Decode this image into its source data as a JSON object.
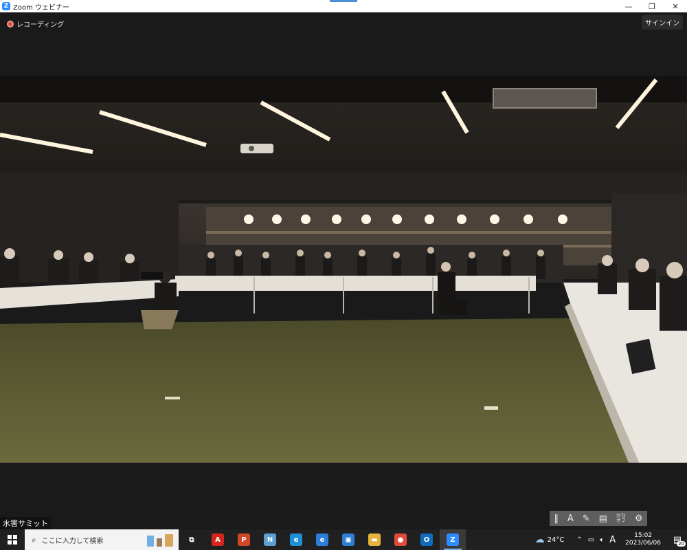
{
  "window": {
    "title": "Zoom ウェビナー",
    "app_icon_letter": "Z",
    "minimize": "—",
    "maximize": "❐",
    "close": "✕"
  },
  "zoom": {
    "recording_label": "レコーディング",
    "signin_label": "サインイン",
    "caption_label": "水害サミット"
  },
  "toolpanel": {
    "grip": "‖",
    "text_tool": "A",
    "kana_top": "かな",
    "kana_bottom": "オフ",
    "settings": "⚙"
  },
  "taskbar": {
    "search_placeholder": "ここに入力して検索",
    "apps": [
      {
        "name": "task-view-icon",
        "glyph": "⧉",
        "color": "#202020"
      },
      {
        "name": "acrobat-icon",
        "glyph": "A",
        "color": "#d4261f"
      },
      {
        "name": "powerpoint-icon",
        "glyph": "P",
        "color": "#d24726"
      },
      {
        "name": "notepad-icon",
        "glyph": "N",
        "color": "#5aa0d6"
      },
      {
        "name": "edge-icon",
        "glyph": "e",
        "color": "#1f8fd6"
      },
      {
        "name": "ie-icon",
        "glyph": "e",
        "color": "#2b7fd8"
      },
      {
        "name": "store-icon",
        "glyph": "▣",
        "color": "#2d7fd4"
      },
      {
        "name": "explorer-icon",
        "glyph": "▬",
        "color": "#e8b33c"
      },
      {
        "name": "chrome-icon",
        "glyph": "●",
        "color": "#dd4b39"
      },
      {
        "name": "outlook-icon",
        "glyph": "O",
        "color": "#0f6cbd"
      },
      {
        "name": "zoom-icon",
        "glyph": "Z",
        "color": "#2d8cff"
      }
    ],
    "temperature": "24°C",
    "ime": "A",
    "time": "15:02",
    "date": "2023/06/06",
    "notification_count": "20"
  }
}
